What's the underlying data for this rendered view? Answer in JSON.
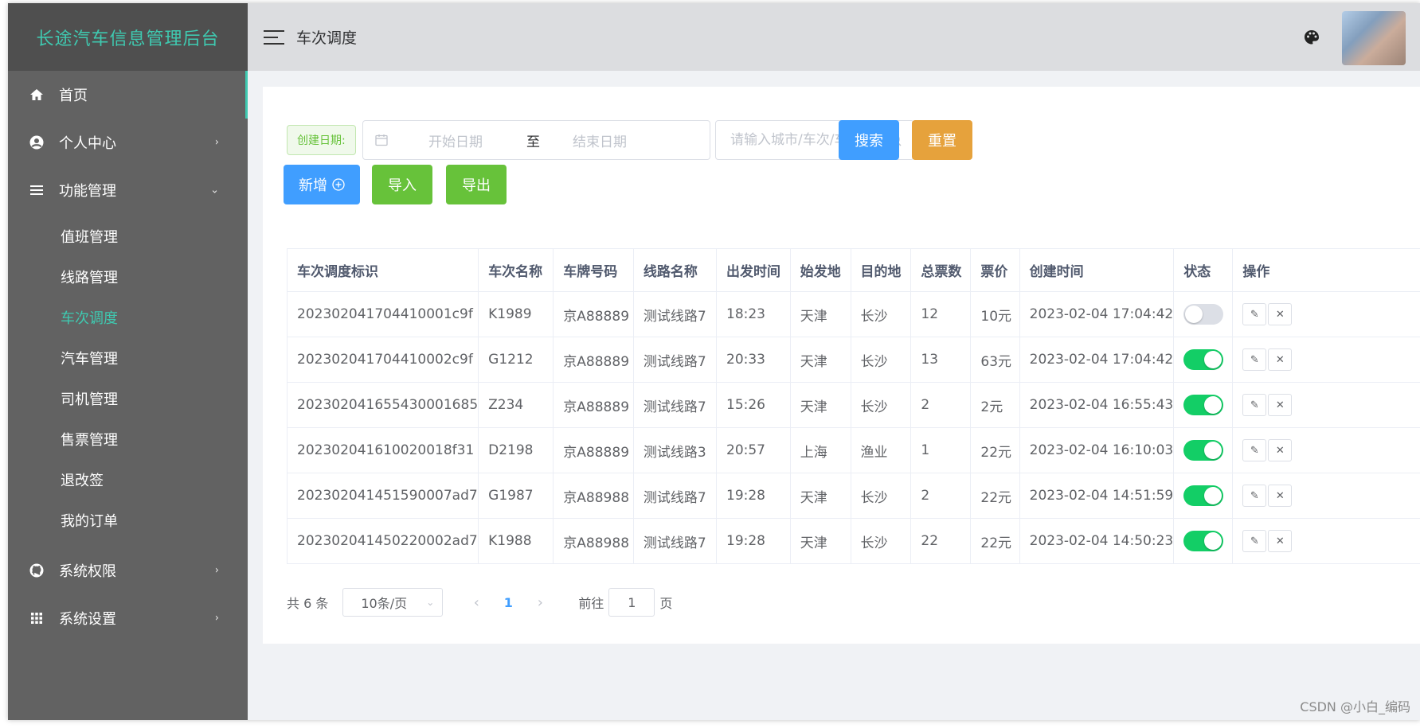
{
  "app": {
    "title": "长途汽车信息管理后台"
  },
  "sidebar": {
    "items": [
      {
        "label": "首页",
        "icon": "home-icon",
        "arrow": ""
      },
      {
        "label": "个人中心",
        "icon": "user-circle-icon",
        "arrow": "›"
      },
      {
        "label": "功能管理",
        "icon": "list-icon",
        "arrow": "⌄"
      }
    ],
    "sub_items": [
      {
        "label": "值班管理"
      },
      {
        "label": "线路管理"
      },
      {
        "label": "车次调度"
      },
      {
        "label": "汽车管理"
      },
      {
        "label": "司机管理"
      },
      {
        "label": "售票管理"
      },
      {
        "label": "退改签"
      },
      {
        "label": "我的订单"
      }
    ],
    "bottom_items": [
      {
        "label": "系统权限",
        "icon": "github-icon",
        "arrow": "›"
      },
      {
        "label": "系统设置",
        "icon": "grid-icon",
        "arrow": "›"
      }
    ]
  },
  "header": {
    "title": "车次调度",
    "palette_icon": "palette-icon"
  },
  "filters": {
    "date_tag": "创建日期:",
    "start_placeholder": "开始日期",
    "separator": "至",
    "end_placeholder": "结束日期",
    "search_placeholder": "请输入城市/车次/车牌",
    "search_label": "搜索",
    "reset_label": "重置"
  },
  "actions": {
    "add_label": "新增",
    "import_label": "导入",
    "export_label": "导出"
  },
  "colors": {
    "accent": "#3fc9b0",
    "primary": "#409eff",
    "success": "#67c23a",
    "warning": "#e6a23c",
    "switch_on": "#13ce66"
  },
  "table": {
    "columns": [
      "车次调度标识",
      "车次名称",
      "车牌号码",
      "线路名称",
      "出发时间",
      "始发地",
      "目的地",
      "总票数",
      "票价",
      "创建时间",
      "状态",
      "操作"
    ],
    "rows": [
      {
        "id": "202302041704410001c9f",
        "name": "K1989",
        "plate": "京A88889",
        "route": "测试线路7",
        "depart": "18:23",
        "from": "天津",
        "to": "长沙",
        "tickets": "12",
        "price": "10元",
        "created": "2023-02-04 17:04:42",
        "status": false
      },
      {
        "id": "202302041704410002c9f",
        "name": "G1212",
        "plate": "京A88889",
        "route": "测试线路7",
        "depart": "20:33",
        "from": "天津",
        "to": "长沙",
        "tickets": "13",
        "price": "63元",
        "created": "2023-02-04 17:04:42",
        "status": true
      },
      {
        "id": "202302041655430001685",
        "name": "Z234",
        "plate": "京A88889",
        "route": "测试线路7",
        "depart": "15:26",
        "from": "天津",
        "to": "长沙",
        "tickets": "2",
        "price": "2元",
        "created": "2023-02-04 16:55:43",
        "status": true
      },
      {
        "id": "20230204161002001 8f31",
        "name": "D2198",
        "plate": "京A88889",
        "route": "测试线路3",
        "depart": "20:57",
        "from": "上海",
        "to": "渔业",
        "tickets": "1",
        "price": "22元",
        "created": "2023-02-04 16:10:03",
        "status": true
      },
      {
        "id": "202302041451590007ad7",
        "name": "G1987",
        "plate": "京A88988",
        "route": "测试线路7",
        "depart": "19:28",
        "from": "天津",
        "to": "长沙",
        "tickets": "2",
        "price": "22元",
        "created": "2023-02-04 14:51:59",
        "status": true
      },
      {
        "id": "202302041450220002ad7",
        "name": "K1988",
        "plate": "京A88988",
        "route": "测试线路7",
        "depart": "19:28",
        "from": "天津",
        "to": "长沙",
        "tickets": "22",
        "price": "22元",
        "created": "2023-02-04 14:50:23",
        "status": true
      }
    ]
  },
  "pagination": {
    "total": "共 6 条",
    "page_size": "10条/页",
    "current_page": "1",
    "goto_prefix": "前往",
    "goto_value": "1",
    "goto_suffix": "页"
  },
  "watermark": "CSDN @小白_编码"
}
